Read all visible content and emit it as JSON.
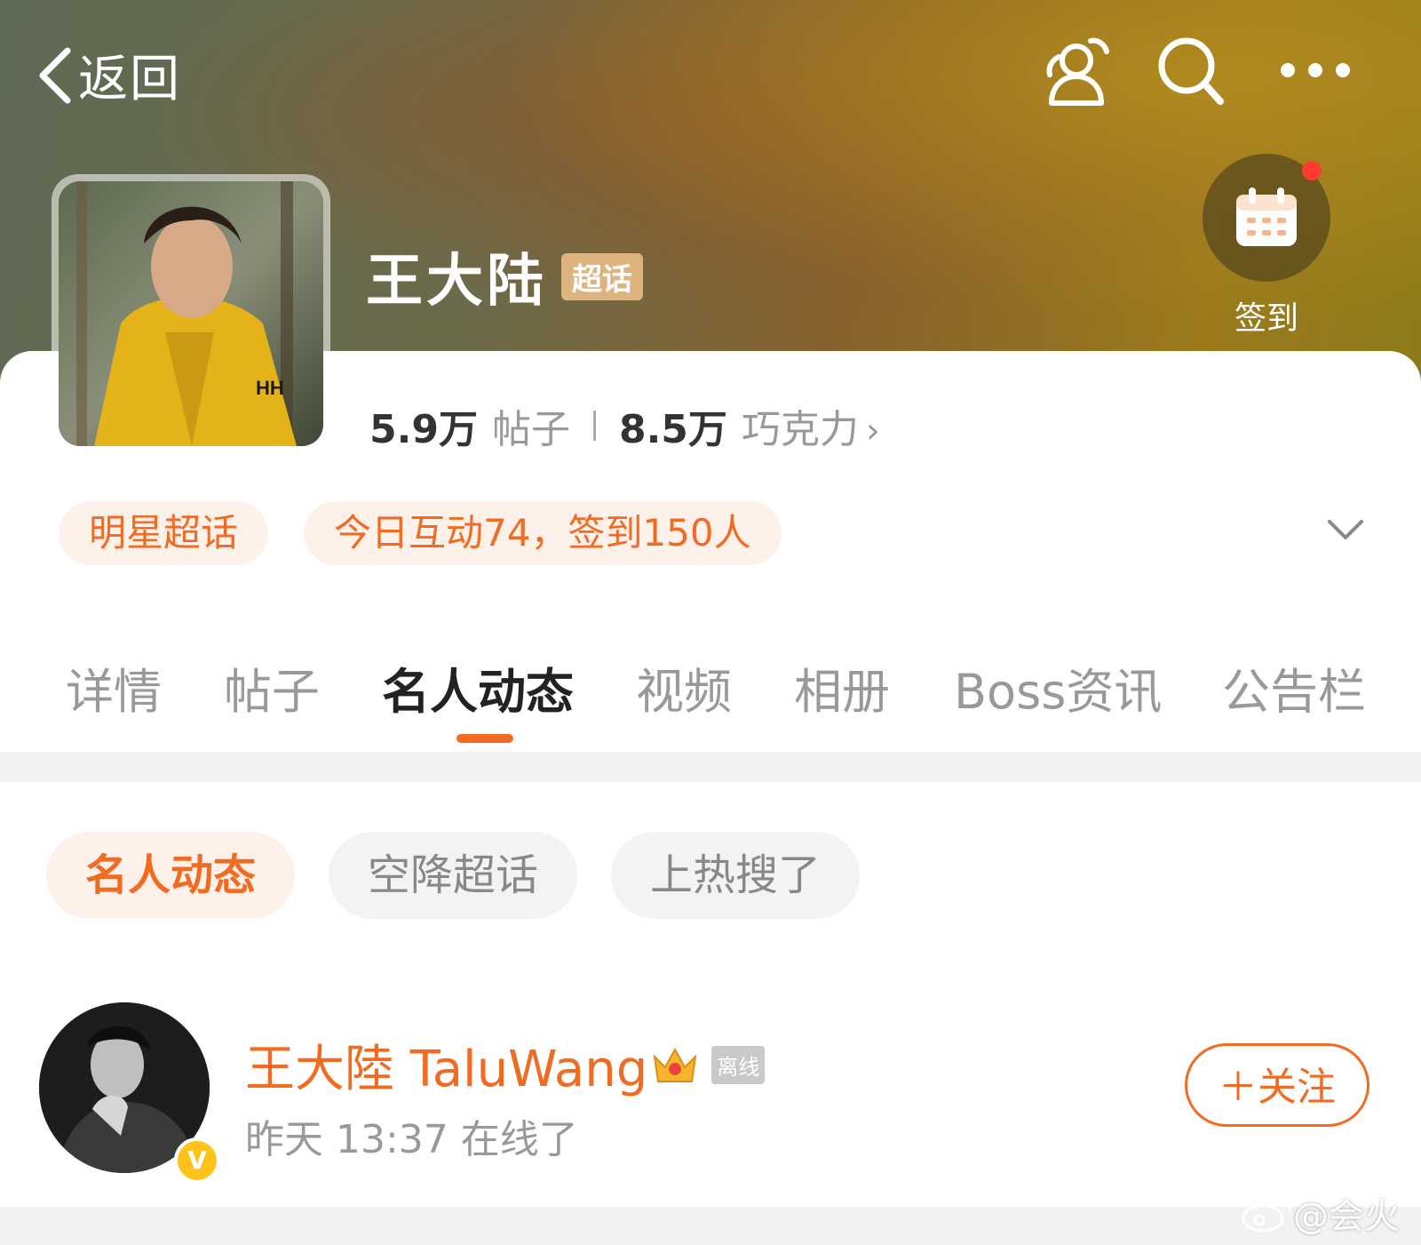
{
  "nav": {
    "back_label": "返回",
    "icons": [
      "back-chevron-icon",
      "people-group-icon",
      "search-icon",
      "more-dots-icon"
    ]
  },
  "topic": {
    "title": "王大陆",
    "tag": "超话",
    "checkin_label": "签到"
  },
  "stats": {
    "posts_value": "5.9万",
    "posts_label": "帖子",
    "chocolate_value": "8.5万",
    "chocolate_label": "巧克力",
    "chocolate_arrow": "›"
  },
  "chips": [
    "明星超话",
    "今日互动74，签到150人"
  ],
  "tabs": [
    {
      "label": "详情",
      "active": false
    },
    {
      "label": "帖子",
      "active": false
    },
    {
      "label": "名人动态",
      "active": true
    },
    {
      "label": "视频",
      "active": false
    },
    {
      "label": "相册",
      "active": false
    },
    {
      "label": "Boss资讯",
      "active": false
    },
    {
      "label": "公告栏",
      "active": false
    }
  ],
  "filters": [
    {
      "label": "名人动态",
      "active": true
    },
    {
      "label": "空降超话",
      "active": false
    },
    {
      "label": "上热搜了",
      "active": false
    }
  ],
  "profile": {
    "name": "王大陸 TaluWang",
    "status": "离线",
    "verified_mark": "V",
    "online_text": "昨天 13:37 在线了",
    "follow_label": "＋关注"
  },
  "watermark": "@会火",
  "colors": {
    "accent": "#f26b22",
    "chip_bg": "#fdf1ea",
    "muted": "#999999",
    "verified": "#ffc21a"
  }
}
